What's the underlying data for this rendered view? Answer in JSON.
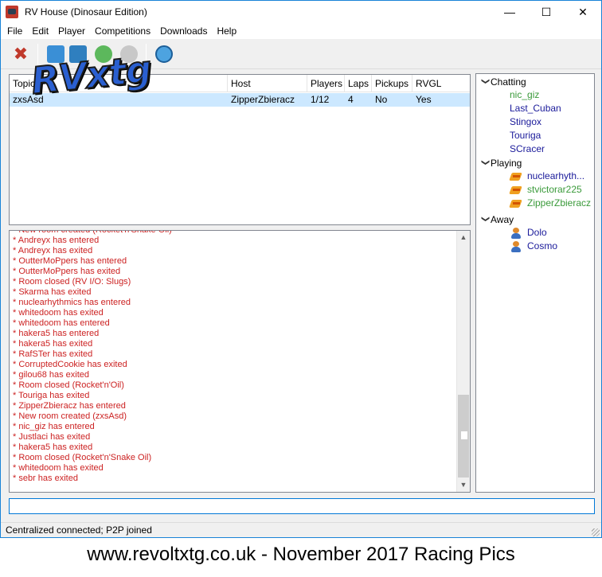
{
  "window": {
    "title": "RV House (Dinosaur Edition)"
  },
  "menu": [
    {
      "label": "File"
    },
    {
      "label": "Edit"
    },
    {
      "label": "Player"
    },
    {
      "label": "Competitions"
    },
    {
      "label": "Downloads"
    },
    {
      "label": "Help"
    }
  ],
  "toolbar": {
    "icons": [
      "close-x-icon",
      "host-room-icon",
      "join-room-icon",
      "refresh-icon",
      "disabled-globe-icon",
      "connection-icon"
    ]
  },
  "overlay_logo": "RVxtg",
  "rooms": {
    "columns": [
      "Topic",
      "Host",
      "Players",
      "Laps",
      "Pickups",
      "RVGL"
    ],
    "rows": [
      {
        "topic": "zxsAsd",
        "host": "ZipperZbieracz",
        "players": "1/12",
        "laps": "4",
        "pickups": "No",
        "rvgl": "Yes"
      }
    ]
  },
  "log": [
    "* New room created (Rocket'n'Snake Oil)",
    "* Andreyx has entered",
    "* Andreyx has exited",
    "* OutterMoPpers has entered",
    "* OutterMoPpers has exited",
    "* Room closed (RV I/O: Slugs)",
    "* Skarma has exited",
    "* nuclearhythmics has entered",
    "* whitedoom has exited",
    "* whitedoom has entered",
    "* hakera5 has entered",
    "* hakera5 has exited",
    "* RafSTer has exited",
    "* CorruptedCookie has exited",
    "* gilou68 has exited",
    "* Room closed (Rocket'n'Oil)",
    "* Touriga has exited",
    "* ZipperZbieracz has entered",
    "* New room created (zxsAsd)",
    "* nic_giz has entered",
    "* Justlaci has exited",
    "* hakera5 has exited",
    "* Room closed (Rocket'n'Snake Oil)",
    "* whitedoom has exited",
    "* sebr has exited"
  ],
  "users": {
    "chatting_label": "Chatting",
    "chatting": [
      {
        "name": "nic_giz",
        "color": "#3a9a3a"
      },
      {
        "name": "Last_Cuban",
        "color": "#1a1a9a"
      },
      {
        "name": "Stingox",
        "color": "#1a1a9a"
      },
      {
        "name": "Touriga",
        "color": "#1a1a9a"
      },
      {
        "name": "SCracer",
        "color": "#1a1a9a"
      }
    ],
    "playing_label": "Playing",
    "playing": [
      {
        "name": "nuclearhyth...",
        "color": "#1a1a9a"
      },
      {
        "name": "stvictorar225",
        "color": "#3a9a3a"
      },
      {
        "name": "ZipperZbieracz",
        "color": "#3a9a3a"
      }
    ],
    "away_label": "Away",
    "away": [
      {
        "name": "Dolo",
        "color": "#1a1a9a"
      },
      {
        "name": "Cosmo",
        "color": "#1a1a9a"
      }
    ]
  },
  "chat_input": {
    "value": ""
  },
  "status": "Centralized connected; P2P joined",
  "caption": "www.revoltxtg.co.uk - November 2017 Racing Pics"
}
